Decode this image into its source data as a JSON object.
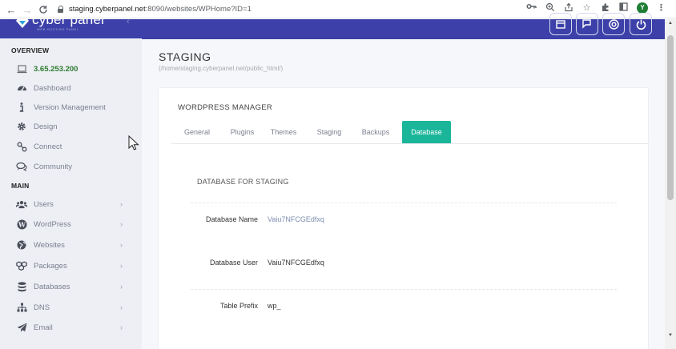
{
  "browser": {
    "url_host": "staging.cyberpanel.net",
    "url_path": ":8090/websites/WPHome?ID=1",
    "profile_initial": "Y"
  },
  "brand": {
    "name": "cyber panel",
    "tagline": "WEB HOSTING PANEL",
    "accent": "#3c40a8",
    "tab_active_color": "#1bb69a"
  },
  "sidebar": {
    "sections": [
      {
        "title": "OVERVIEW",
        "items": [
          {
            "label": "3.65.253.200",
            "icon": "laptop-icon",
            "active": true
          },
          {
            "label": "Dashboard",
            "icon": "dashboard-icon"
          },
          {
            "label": "Version Management",
            "icon": "info-icon"
          },
          {
            "label": "Design",
            "icon": "gear-icon"
          },
          {
            "label": "Connect",
            "icon": "link-icon"
          },
          {
            "label": "Community",
            "icon": "comments-icon"
          }
        ]
      },
      {
        "title": "MAIN",
        "items": [
          {
            "label": "Users",
            "icon": "users-icon",
            "has_children": true
          },
          {
            "label": "WordPress",
            "icon": "wordpress-icon",
            "has_children": true
          },
          {
            "label": "Websites",
            "icon": "globe-icon",
            "has_children": true
          },
          {
            "label": "Packages",
            "icon": "cubes-icon",
            "has_children": true
          },
          {
            "label": "Databases",
            "icon": "database-icon",
            "has_children": true
          },
          {
            "label": "DNS",
            "icon": "sitemap-icon",
            "has_children": true
          },
          {
            "label": "Email",
            "icon": "paper-plane-icon",
            "has_children": true
          }
        ]
      }
    ]
  },
  "page": {
    "title": "STAGING",
    "path": "(/home/staging.cyberpanel.net/public_html/)"
  },
  "wp_manager": {
    "title": "WORDPRESS MANAGER",
    "tabs": [
      "General",
      "Plugins",
      "Themes",
      "Staging",
      "Backups",
      "Database"
    ],
    "active_tab": "Database"
  },
  "database": {
    "title": "DATABASE FOR STAGING",
    "rows": [
      {
        "label": "Database Name",
        "value": "Vaiu7NFCGEdfxq"
      },
      {
        "label": "Database User",
        "value": "Vaiu7NFCGEdfxq"
      },
      {
        "label": "Table Prefix",
        "value": "wp_"
      }
    ]
  }
}
